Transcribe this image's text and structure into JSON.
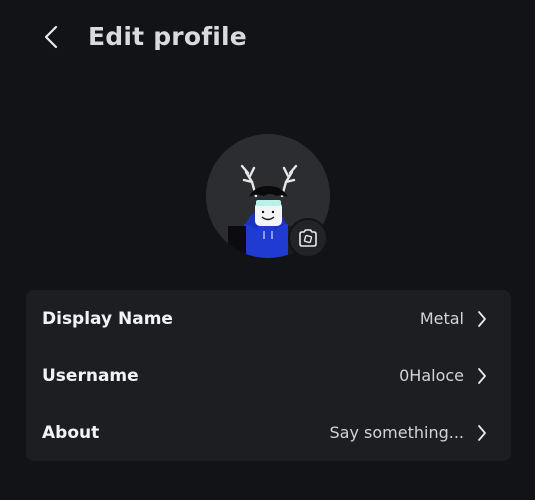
{
  "header": {
    "title": "Edit profile",
    "back_icon": "chevron-left-icon"
  },
  "avatar": {
    "camera_icon": "camera-icon"
  },
  "settings": {
    "rows": [
      {
        "label": "Display Name",
        "value": "Metal",
        "icon": "chevron-right-icon"
      },
      {
        "label": "Username",
        "value": "0Haloce",
        "icon": "chevron-right-icon"
      },
      {
        "label": "About",
        "value": "Say something...",
        "icon": "chevron-right-icon"
      }
    ]
  },
  "colors": {
    "background": "#121317",
    "card": "#1d1e22",
    "text": "#f2f3f5",
    "title": "#d9dadd",
    "avatar_bg": "#2c2d31",
    "avatar_hoodie": "#1f3bd1"
  }
}
